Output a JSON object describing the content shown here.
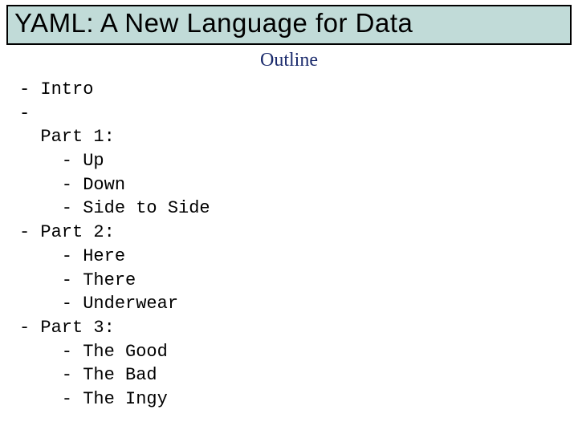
{
  "title": "YAML: A New Language for Data",
  "subtitle": "Outline",
  "code_text": "- Intro\n-\n  Part 1:\n    - Up\n    - Down\n    - Side to Side\n- Part 2:\n    - Here\n    - There\n    - Underwear\n- Part 3:\n    - The Good\n    - The Bad\n    - The Ingy"
}
